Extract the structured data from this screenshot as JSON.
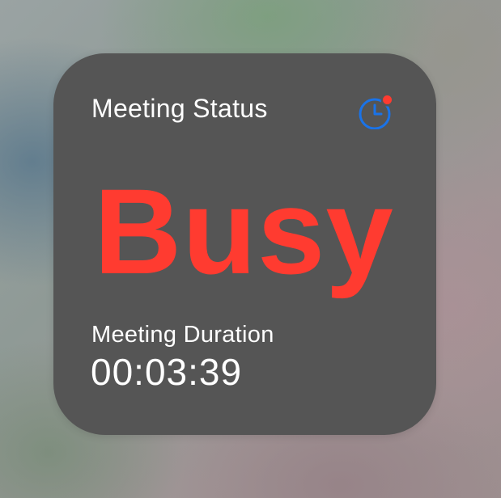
{
  "widget": {
    "title": "Meeting Status",
    "status": "Busy",
    "duration_label": "Meeting Duration",
    "duration_value": "00:03:39",
    "icon": "timer-icon"
  },
  "colors": {
    "widget_background": "#555555",
    "status": "#ff3b30",
    "icon_accent": "#1a73e8",
    "icon_badge": "#ff3b30",
    "text": "#ffffff"
  }
}
